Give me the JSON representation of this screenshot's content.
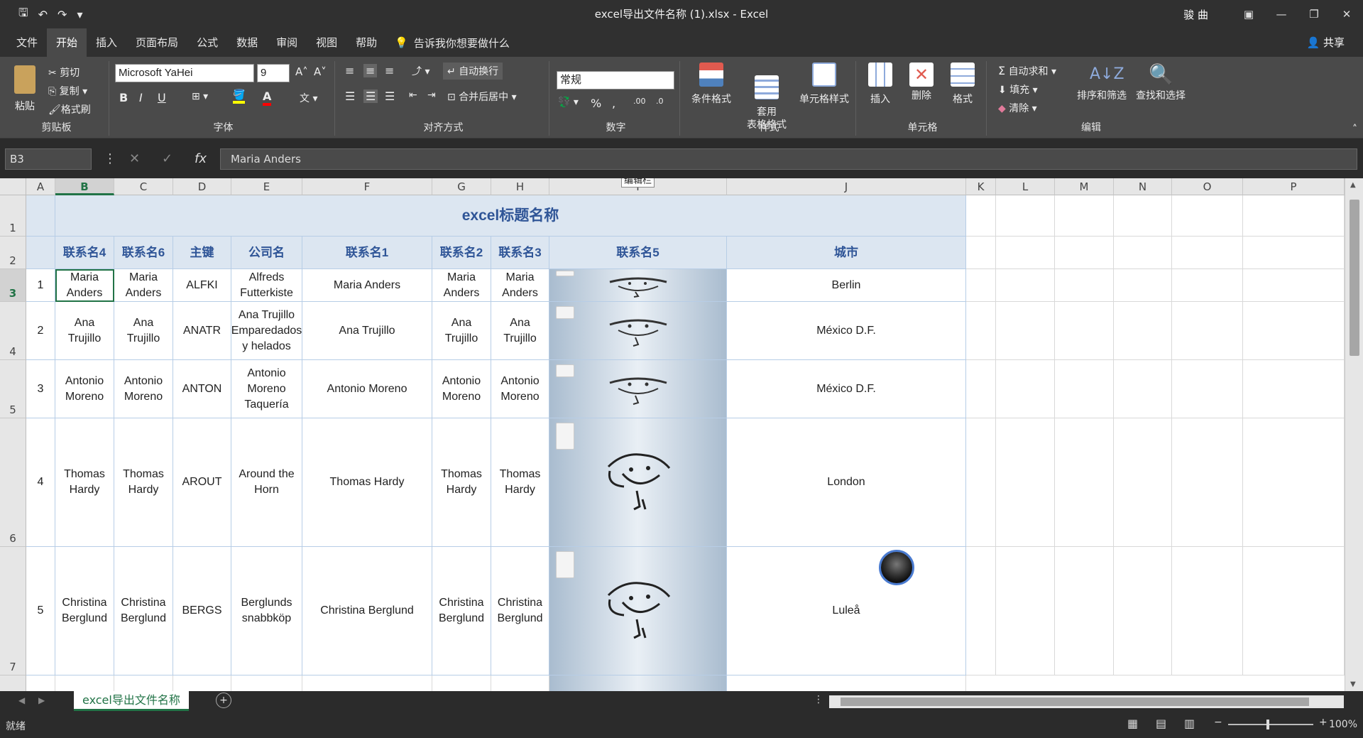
{
  "window": {
    "title": "excel导出文件名称 (1).xlsx  -  Excel",
    "user": "骏 曲"
  },
  "menu": {
    "tabs": [
      "文件",
      "开始",
      "插入",
      "页面布局",
      "公式",
      "数据",
      "审阅",
      "视图",
      "帮助"
    ],
    "tell_me": "告诉我你想要做什么",
    "share": "共享"
  },
  "ribbon": {
    "clipboard": {
      "paste": "粘贴",
      "cut": "剪切",
      "copy": "复制",
      "format_painter": "格式刷",
      "label": "剪贴板"
    },
    "font": {
      "name": "Microsoft YaHei",
      "size": "9",
      "bold": "B",
      "italic": "I",
      "underline": "U",
      "label": "字体"
    },
    "alignment": {
      "wrap": "自动换行",
      "merge": "合并后居中",
      "label": "对齐方式"
    },
    "number": {
      "format": "常规",
      "label": "数字"
    },
    "styles": {
      "conditional": "条件格式",
      "table_format": "套用\n表格格式",
      "cell_styles": "单元格样式",
      "label": "样式"
    },
    "cells": {
      "insert": "插入",
      "delete": "删除",
      "format": "格式",
      "label": "单元格"
    },
    "editing": {
      "autosum": "自动求和",
      "fill": "填充",
      "clear": "清除",
      "sort": "排序和筛选",
      "find": "查找和选择",
      "label": "编辑"
    }
  },
  "formula_bar": {
    "name_box": "B3",
    "value": "Maria Anders",
    "tooltip": "编辑栏"
  },
  "columns": [
    "A",
    "B",
    "C",
    "D",
    "E",
    "F",
    "G",
    "H",
    "I",
    "J",
    "K",
    "L",
    "M",
    "N",
    "O",
    "P"
  ],
  "rows": [
    "1",
    "2",
    "3",
    "4",
    "5",
    "6",
    "7"
  ],
  "sheet": {
    "title": "excel标题名称",
    "headers": [
      "联系名4",
      "联系名6",
      "主键",
      "公司名",
      "联系名1",
      "联系名2",
      "联系名3",
      "联系名5",
      "城市"
    ],
    "records": [
      {
        "idx": "1",
        "c4": "Maria Anders",
        "c6": "Maria Anders",
        "key": "ALFKI",
        "company": "Alfreds Futterkiste",
        "c1": "Maria Anders",
        "c2": "Maria Anders",
        "c3": "Maria Anders",
        "city": "Berlin"
      },
      {
        "idx": "2",
        "c4": "Ana Trujillo",
        "c6": "Ana Trujillo",
        "key": "ANATR",
        "company": "Ana Trujillo Emparedados y helados",
        "c1": "Ana Trujillo",
        "c2": "Ana Trujillo",
        "c3": "Ana Trujillo",
        "city": "México D.F."
      },
      {
        "idx": "3",
        "c4": "Antonio Moreno",
        "c6": "Antonio Moreno",
        "key": "ANTON",
        "company": "Antonio Moreno Taquería",
        "c1": "Antonio Moreno",
        "c2": "Antonio Moreno",
        "c3": "Antonio Moreno",
        "city": "México D.F."
      },
      {
        "idx": "4",
        "c4": "Thomas Hardy",
        "c6": "Thomas Hardy",
        "key": "AROUT",
        "company": "Around the Horn",
        "c1": "Thomas Hardy",
        "c2": "Thomas Hardy",
        "c3": "Thomas Hardy",
        "city": "London"
      },
      {
        "idx": "5",
        "c4": "Christina Berglund",
        "c6": "Christina Berglund",
        "key": "BERGS",
        "company": "Berglunds snabbköp",
        "c1": "Christina Berglund",
        "c2": "Christina Berglund",
        "c3": "Christina Berglund",
        "city": "Luleå"
      }
    ]
  },
  "sheet_tab": "excel导出文件名称",
  "status": {
    "ready": "就绪",
    "zoom": "100%"
  }
}
